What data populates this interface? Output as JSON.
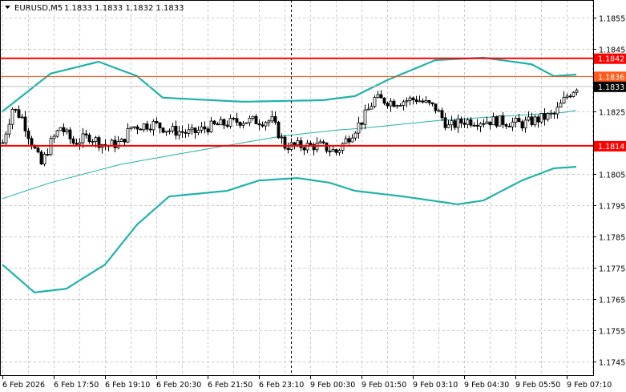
{
  "header": {
    "symbol": "EURUSD,M5",
    "ohlc": "1.1833 1.1833 1.1832 1.1833",
    "menu_icon": "triangle-down-icon"
  },
  "chart_data": {
    "type": "candlestick",
    "title": "EURUSD,M5 1.1833 1.1833 1.1832 1.1833",
    "ylim": [
      1.17395,
      1.18614
    ],
    "y_ticks": [
      "1.1855",
      "1.1845",
      "1.1825",
      "1.1805",
      "1.1795",
      "1.1785",
      "1.1775",
      "1.1765",
      "1.1755",
      "1.1745"
    ],
    "y_tick_values": [
      1.1855,
      1.1845,
      1.1825,
      1.1805,
      1.1795,
      1.1785,
      1.1775,
      1.1765,
      1.1755,
      1.1745
    ],
    "x_ticks": [
      "6 Feb 2026",
      "6 Feb 17:50",
      "6 Feb 19:10",
      "6 Feb 20:30",
      "6 Feb 21:50",
      "6 Feb 23:10",
      "9 Feb 00:30",
      "9 Feb 01:50",
      "9 Feb 03:10",
      "9 Feb 04:30",
      "9 Feb 05:50",
      "9 Feb 07:10"
    ],
    "x_tick_index": [
      0,
      16,
      32,
      48,
      64,
      80,
      96,
      112,
      128,
      144,
      160,
      176
    ],
    "candle_count": 180,
    "close_anchors": [
      [
        0,
        1.1815
      ],
      [
        3,
        1.1826
      ],
      [
        6,
        1.1823
      ],
      [
        9,
        1.1815
      ],
      [
        12,
        1.1808
      ],
      [
        15,
        1.1815
      ],
      [
        18,
        1.182
      ],
      [
        22,
        1.1815
      ],
      [
        27,
        1.1817
      ],
      [
        32,
        1.1814
      ],
      [
        37,
        1.1815
      ],
      [
        40,
        1.182
      ],
      [
        47,
        1.1821
      ],
      [
        52,
        1.1819
      ],
      [
        59,
        1.1818
      ],
      [
        64,
        1.182
      ],
      [
        74,
        1.1822
      ],
      [
        84,
        1.1822
      ],
      [
        88,
        1.1814
      ],
      [
        99,
        1.1814
      ],
      [
        104,
        1.1812
      ],
      [
        108,
        1.1817
      ],
      [
        112,
        1.1822
      ],
      [
        116,
        1.1829
      ],
      [
        122,
        1.1828
      ],
      [
        129,
        1.1829
      ],
      [
        135,
        1.1826
      ],
      [
        139,
        1.182
      ],
      [
        144,
        1.1822
      ],
      [
        154,
        1.1822
      ],
      [
        162,
        1.1821
      ],
      [
        172,
        1.1824
      ],
      [
        176,
        1.183
      ],
      [
        179,
        1.1833
      ]
    ],
    "series": [
      {
        "name": "Bollinger upper",
        "color": "#20b2aa",
        "points": [
          [
            0,
            1.1825
          ],
          [
            15,
            1.18371
          ],
          [
            30,
            1.18409
          ],
          [
            42,
            1.18363
          ],
          [
            50,
            1.18294
          ],
          [
            75,
            1.18281
          ],
          [
            100,
            1.18286
          ],
          [
            110,
            1.18299
          ],
          [
            120,
            1.1835
          ],
          [
            135,
            1.18414
          ],
          [
            150,
            1.18422
          ],
          [
            165,
            1.18401
          ],
          [
            172,
            1.18363
          ],
          [
            179,
            1.18368
          ]
        ]
      },
      {
        "name": "Bollinger lower",
        "color": "#20b2aa",
        "points": [
          [
            0,
            1.1776
          ],
          [
            10,
            1.17671
          ],
          [
            20,
            1.17683
          ],
          [
            32,
            1.1776
          ],
          [
            42,
            1.17888
          ],
          [
            52,
            1.17978
          ],
          [
            70,
            1.17996
          ],
          [
            80,
            1.18029
          ],
          [
            92,
            1.18037
          ],
          [
            102,
            1.18022
          ],
          [
            110,
            1.17996
          ],
          [
            125,
            1.17978
          ],
          [
            142,
            1.17953
          ],
          [
            150,
            1.17965
          ],
          [
            162,
            1.18029
          ],
          [
            172,
            1.18068
          ],
          [
            179,
            1.18073
          ]
        ]
      },
      {
        "name": "Moving average",
        "color": "#20b2aa",
        "points": [
          [
            0,
            1.17971
          ],
          [
            15,
            1.18022
          ],
          [
            37,
            1.18081
          ],
          [
            65,
            1.18132
          ],
          [
            87,
            1.18171
          ],
          [
            105,
            1.18191
          ],
          [
            112,
            1.18196
          ],
          [
            137,
            1.18222
          ],
          [
            175,
            1.18247
          ],
          [
            179,
            1.18253
          ]
        ]
      }
    ],
    "levels": [
      {
        "value": "1.1842",
        "price": 1.1842,
        "color": "#ff0000",
        "label_bg": "#ff0000"
      },
      {
        "value": "1.1836",
        "price": 1.18362,
        "color": "#ff4500",
        "label_bg": "#ff5a1a"
      },
      {
        "value": "1.1814",
        "price": 1.1814,
        "color": "#ff0000",
        "label_bg": "#ff0000"
      }
    ],
    "current_price": {
      "value": "1.1833",
      "price": 1.1833,
      "label_bg": "#000000"
    },
    "vline_index": 90,
    "grid": true
  }
}
